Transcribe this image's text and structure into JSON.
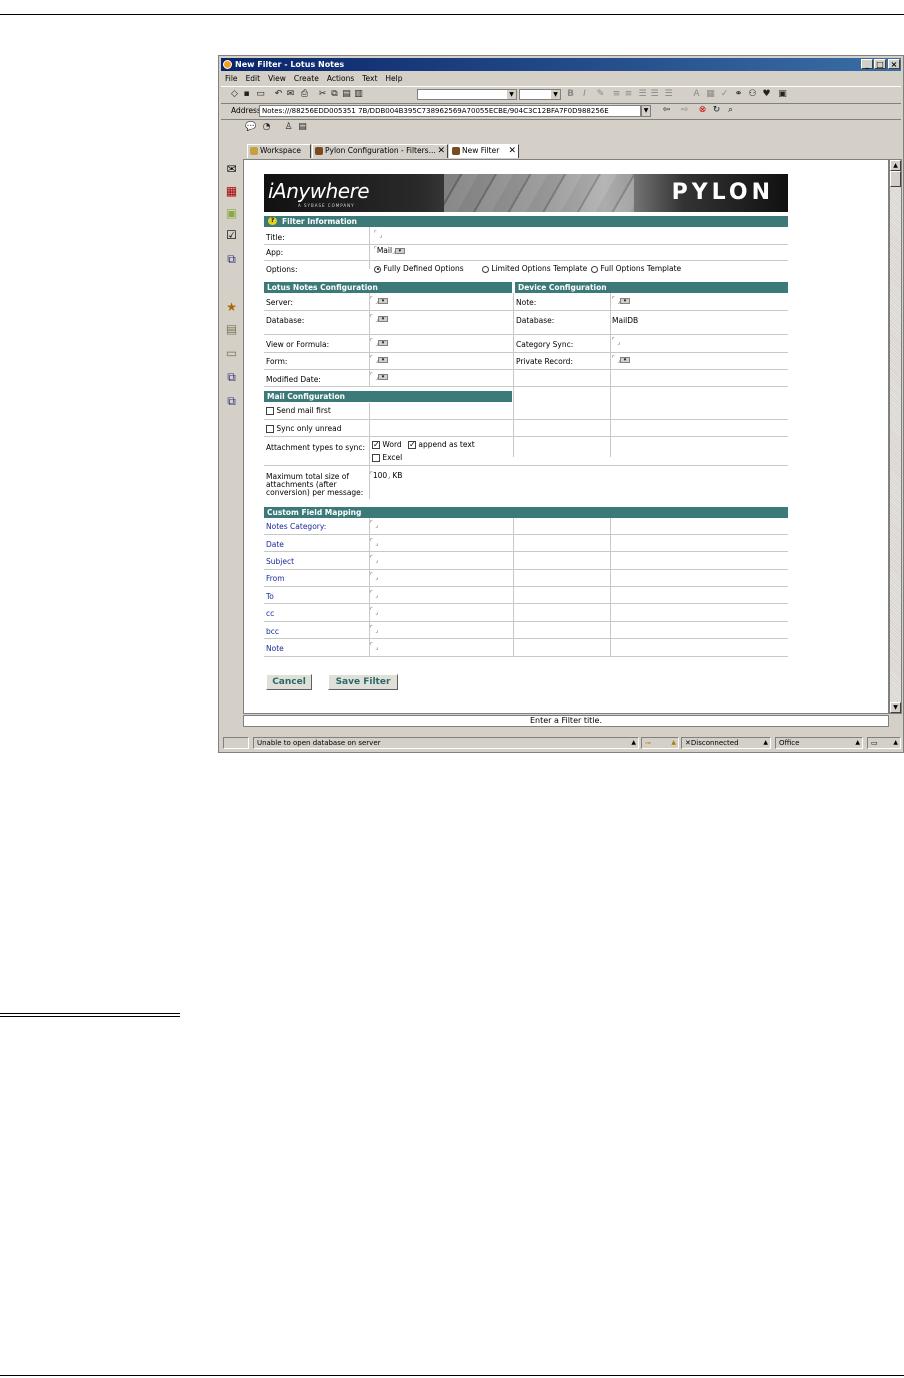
{
  "window": {
    "title": "New Filter - Lotus Notes",
    "controls": [
      "_",
      "□",
      "×"
    ]
  },
  "menu": [
    "File",
    "Edit",
    "View",
    "Create",
    "Actions",
    "Text",
    "Help"
  ],
  "address": {
    "label": "Address",
    "value": "Notes:///88256EDD005351 7B/DDB004B395C738962569A70055ECBE/904C3C12BFA7F0D988256E"
  },
  "tabs": [
    {
      "label": "Workspace"
    },
    {
      "label": "Pylon Configuration - Filters..."
    },
    {
      "label": "New Filter"
    }
  ],
  "banner": {
    "brand": "iAnywhere",
    "brand_sub": "A SYBASE COMPANY",
    "product": "PYLON"
  },
  "filter_info": {
    "header": "Filter Information",
    "title_label": "Title:",
    "app_label": "App:",
    "app_value": "Mail",
    "options_label": "Options:",
    "options": [
      "Fully Defined Options",
      "Limited Options Template",
      "Full Options Template"
    ]
  },
  "lotus": {
    "header": "Lotus Notes Configuration",
    "server": "Server:",
    "database": "Database:",
    "view": "View or Formula:",
    "form": "Form:",
    "modified": "Modified Date:"
  },
  "device": {
    "header": "Device Configuration",
    "note": "Note:",
    "database": "Database:",
    "database_value": "MailDB",
    "category_sync": "Category Sync:",
    "private_record": "Private Record:"
  },
  "mail": {
    "header": "Mail Configuration",
    "send_mail_first": "Send mail first",
    "sync_only_unread": "Sync only unread",
    "attach_label": "Attachment types to sync:",
    "word": "Word",
    "append": "append as text",
    "excel": "Excel",
    "max_label_1": "Maximum total size of",
    "max_label_2": "attachments (after",
    "max_label_3": "conversion) per message:",
    "max_value": "100",
    "max_unit": "KB"
  },
  "custom": {
    "header": "Custom Field Mapping",
    "fields": [
      "Notes Category:",
      "Date",
      "Subject",
      "From",
      "To",
      "cc",
      "bcc",
      "Note"
    ]
  },
  "buttons": {
    "cancel": "Cancel",
    "save": "Save Filter"
  },
  "hint": "Enter a Filter title.",
  "status": {
    "message": "Unable to open database  on server",
    "connection": "Disconnected",
    "location": "Office"
  }
}
